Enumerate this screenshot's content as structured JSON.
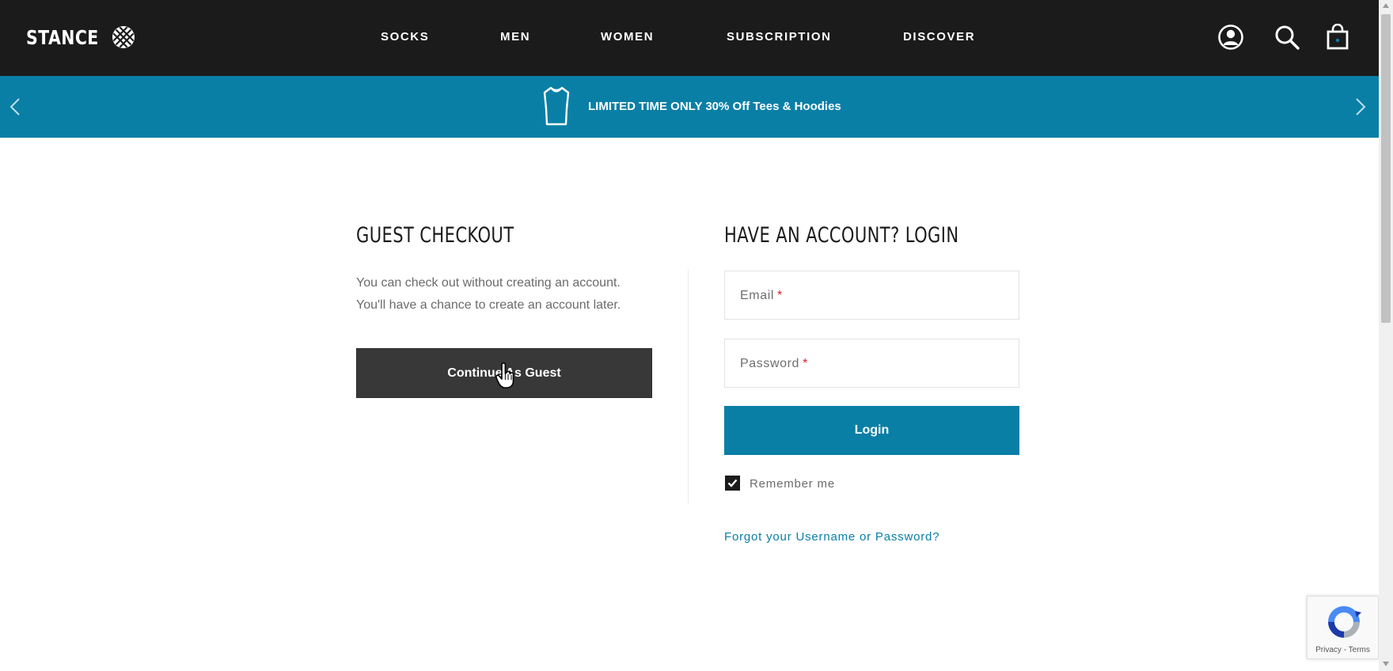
{
  "header": {
    "logo_text": "STANCE",
    "nav": [
      {
        "label": "SOCKS"
      },
      {
        "label": "MEN"
      },
      {
        "label": "WOMEN"
      },
      {
        "label": "SUBSCRIPTION"
      },
      {
        "label": "DISCOVER"
      }
    ],
    "icons": [
      "account-icon",
      "search-icon",
      "shopping-bag-icon"
    ],
    "background": "#1b1b1b"
  },
  "promo": {
    "text": "LIMITED TIME ONLY 30% Off Tees & Hoodies",
    "background": "#0a7fa6",
    "icons": [
      "chevron-left-icon",
      "tshirt-icon",
      "chevron-right-icon"
    ]
  },
  "guest": {
    "title": "GUEST CHECKOUT",
    "description_line1": "You can check out without creating an account.",
    "description_line2": "You'll have a chance to create an account later.",
    "button_label": "Continue As Guest"
  },
  "login": {
    "title": "HAVE AN ACCOUNT? LOGIN",
    "email_label": "Email",
    "password_label": "Password",
    "required_marker": "*",
    "button_label": "Login",
    "remember_label": "Remember me",
    "remember_checked": true,
    "forgot_label": "Forgot your Username or Password?",
    "accent": "#0a7fa6"
  },
  "recaptcha": {
    "label": "Privacy - Terms"
  }
}
